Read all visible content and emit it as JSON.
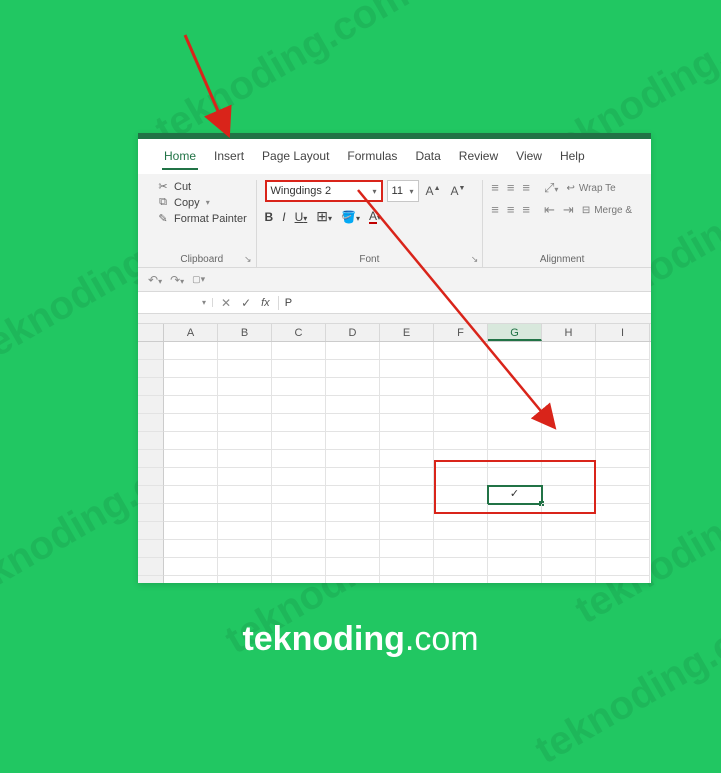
{
  "watermark": "teknoding.com",
  "brand_bold": "teknoding",
  "brand_suffix": ".com",
  "tabs": {
    "home": "Home",
    "insert": "Insert",
    "page_layout": "Page Layout",
    "formulas": "Formulas",
    "data": "Data",
    "review": "Review",
    "view": "View",
    "help": "Help"
  },
  "clipboard": {
    "cut": "Cut",
    "copy": "Copy",
    "format_painter": "Format Painter",
    "label": "Clipboard"
  },
  "font": {
    "name": "Wingdings 2",
    "size": "11",
    "increase": "A▴",
    "decrease": "A▾",
    "label": "Font"
  },
  "alignment": {
    "wrap": "Wrap Te",
    "merge": "Merge &",
    "label": "Alignment"
  },
  "namebox": "",
  "formula_value": "P",
  "columns": [
    "A",
    "B",
    "C",
    "D",
    "E",
    "F",
    "G",
    "H",
    "I"
  ],
  "selected_cell_value": "✓"
}
